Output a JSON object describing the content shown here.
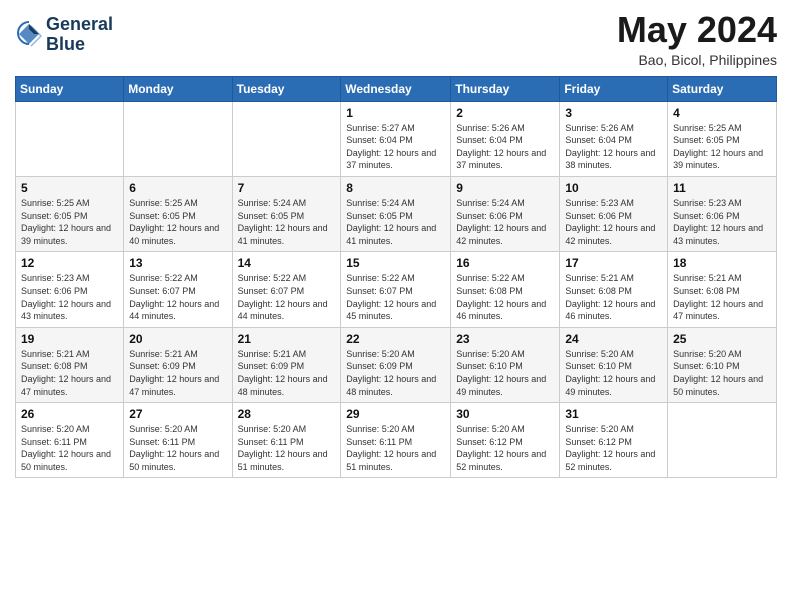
{
  "logo": {
    "name1": "General",
    "name2": "Blue"
  },
  "header": {
    "month_year": "May 2024",
    "location": "Bao, Bicol, Philippines"
  },
  "weekdays": [
    "Sunday",
    "Monday",
    "Tuesday",
    "Wednesday",
    "Thursday",
    "Friday",
    "Saturday"
  ],
  "weeks": [
    [
      {
        "day": "",
        "sunrise": "",
        "sunset": "",
        "daylight": ""
      },
      {
        "day": "",
        "sunrise": "",
        "sunset": "",
        "daylight": ""
      },
      {
        "day": "",
        "sunrise": "",
        "sunset": "",
        "daylight": ""
      },
      {
        "day": "1",
        "sunrise": "Sunrise: 5:27 AM",
        "sunset": "Sunset: 6:04 PM",
        "daylight": "Daylight: 12 hours and 37 minutes."
      },
      {
        "day": "2",
        "sunrise": "Sunrise: 5:26 AM",
        "sunset": "Sunset: 6:04 PM",
        "daylight": "Daylight: 12 hours and 37 minutes."
      },
      {
        "day": "3",
        "sunrise": "Sunrise: 5:26 AM",
        "sunset": "Sunset: 6:04 PM",
        "daylight": "Daylight: 12 hours and 38 minutes."
      },
      {
        "day": "4",
        "sunrise": "Sunrise: 5:25 AM",
        "sunset": "Sunset: 6:05 PM",
        "daylight": "Daylight: 12 hours and 39 minutes."
      }
    ],
    [
      {
        "day": "5",
        "sunrise": "Sunrise: 5:25 AM",
        "sunset": "Sunset: 6:05 PM",
        "daylight": "Daylight: 12 hours and 39 minutes."
      },
      {
        "day": "6",
        "sunrise": "Sunrise: 5:25 AM",
        "sunset": "Sunset: 6:05 PM",
        "daylight": "Daylight: 12 hours and 40 minutes."
      },
      {
        "day": "7",
        "sunrise": "Sunrise: 5:24 AM",
        "sunset": "Sunset: 6:05 PM",
        "daylight": "Daylight: 12 hours and 41 minutes."
      },
      {
        "day": "8",
        "sunrise": "Sunrise: 5:24 AM",
        "sunset": "Sunset: 6:05 PM",
        "daylight": "Daylight: 12 hours and 41 minutes."
      },
      {
        "day": "9",
        "sunrise": "Sunrise: 5:24 AM",
        "sunset": "Sunset: 6:06 PM",
        "daylight": "Daylight: 12 hours and 42 minutes."
      },
      {
        "day": "10",
        "sunrise": "Sunrise: 5:23 AM",
        "sunset": "Sunset: 6:06 PM",
        "daylight": "Daylight: 12 hours and 42 minutes."
      },
      {
        "day": "11",
        "sunrise": "Sunrise: 5:23 AM",
        "sunset": "Sunset: 6:06 PM",
        "daylight": "Daylight: 12 hours and 43 minutes."
      }
    ],
    [
      {
        "day": "12",
        "sunrise": "Sunrise: 5:23 AM",
        "sunset": "Sunset: 6:06 PM",
        "daylight": "Daylight: 12 hours and 43 minutes."
      },
      {
        "day": "13",
        "sunrise": "Sunrise: 5:22 AM",
        "sunset": "Sunset: 6:07 PM",
        "daylight": "Daylight: 12 hours and 44 minutes."
      },
      {
        "day": "14",
        "sunrise": "Sunrise: 5:22 AM",
        "sunset": "Sunset: 6:07 PM",
        "daylight": "Daylight: 12 hours and 44 minutes."
      },
      {
        "day": "15",
        "sunrise": "Sunrise: 5:22 AM",
        "sunset": "Sunset: 6:07 PM",
        "daylight": "Daylight: 12 hours and 45 minutes."
      },
      {
        "day": "16",
        "sunrise": "Sunrise: 5:22 AM",
        "sunset": "Sunset: 6:08 PM",
        "daylight": "Daylight: 12 hours and 46 minutes."
      },
      {
        "day": "17",
        "sunrise": "Sunrise: 5:21 AM",
        "sunset": "Sunset: 6:08 PM",
        "daylight": "Daylight: 12 hours and 46 minutes."
      },
      {
        "day": "18",
        "sunrise": "Sunrise: 5:21 AM",
        "sunset": "Sunset: 6:08 PM",
        "daylight": "Daylight: 12 hours and 47 minutes."
      }
    ],
    [
      {
        "day": "19",
        "sunrise": "Sunrise: 5:21 AM",
        "sunset": "Sunset: 6:08 PM",
        "daylight": "Daylight: 12 hours and 47 minutes."
      },
      {
        "day": "20",
        "sunrise": "Sunrise: 5:21 AM",
        "sunset": "Sunset: 6:09 PM",
        "daylight": "Daylight: 12 hours and 47 minutes."
      },
      {
        "day": "21",
        "sunrise": "Sunrise: 5:21 AM",
        "sunset": "Sunset: 6:09 PM",
        "daylight": "Daylight: 12 hours and 48 minutes."
      },
      {
        "day": "22",
        "sunrise": "Sunrise: 5:20 AM",
        "sunset": "Sunset: 6:09 PM",
        "daylight": "Daylight: 12 hours and 48 minutes."
      },
      {
        "day": "23",
        "sunrise": "Sunrise: 5:20 AM",
        "sunset": "Sunset: 6:10 PM",
        "daylight": "Daylight: 12 hours and 49 minutes."
      },
      {
        "day": "24",
        "sunrise": "Sunrise: 5:20 AM",
        "sunset": "Sunset: 6:10 PM",
        "daylight": "Daylight: 12 hours and 49 minutes."
      },
      {
        "day": "25",
        "sunrise": "Sunrise: 5:20 AM",
        "sunset": "Sunset: 6:10 PM",
        "daylight": "Daylight: 12 hours and 50 minutes."
      }
    ],
    [
      {
        "day": "26",
        "sunrise": "Sunrise: 5:20 AM",
        "sunset": "Sunset: 6:11 PM",
        "daylight": "Daylight: 12 hours and 50 minutes."
      },
      {
        "day": "27",
        "sunrise": "Sunrise: 5:20 AM",
        "sunset": "Sunset: 6:11 PM",
        "daylight": "Daylight: 12 hours and 50 minutes."
      },
      {
        "day": "28",
        "sunrise": "Sunrise: 5:20 AM",
        "sunset": "Sunset: 6:11 PM",
        "daylight": "Daylight: 12 hours and 51 minutes."
      },
      {
        "day": "29",
        "sunrise": "Sunrise: 5:20 AM",
        "sunset": "Sunset: 6:11 PM",
        "daylight": "Daylight: 12 hours and 51 minutes."
      },
      {
        "day": "30",
        "sunrise": "Sunrise: 5:20 AM",
        "sunset": "Sunset: 6:12 PM",
        "daylight": "Daylight: 12 hours and 52 minutes."
      },
      {
        "day": "31",
        "sunrise": "Sunrise: 5:20 AM",
        "sunset": "Sunset: 6:12 PM",
        "daylight": "Daylight: 12 hours and 52 minutes."
      },
      {
        "day": "",
        "sunrise": "",
        "sunset": "",
        "daylight": ""
      }
    ]
  ]
}
